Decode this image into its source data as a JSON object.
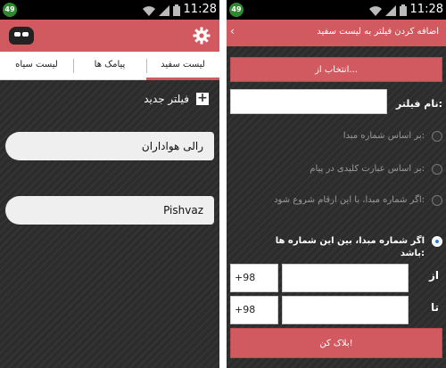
{
  "status_bar": {
    "badge": "49",
    "time": "11:28"
  },
  "left_screen": {
    "tabs": [
      {
        "label": "لیست سفید",
        "active": true
      },
      {
        "label": "پیامک ها",
        "active": false
      },
      {
        "label": "لیست سیاه",
        "active": false
      }
    ],
    "new_filter_label": "فیلتر جدید",
    "filters": [
      "رالی هواداران",
      "Pishvaz"
    ]
  },
  "right_screen": {
    "title": "اضافه کردن فیلتر به لیست سفید",
    "select_button": "انتخاب از...",
    "name_label": "نام فیلتر:",
    "name_value": "",
    "options": [
      {
        "text": "بر اساس شماره مبدا:",
        "selected": false
      },
      {
        "text": "بر اساس عبارت کلیدی در پیام:",
        "selected": false
      },
      {
        "text": "اگر شماره مبدا، با این ارقام شروع شود:",
        "selected": false
      },
      {
        "text": "اگر شماره مبدا، بین این شماره ها باشد:",
        "selected": true
      }
    ],
    "from_label": "از",
    "to_label": "تا",
    "from_prefix": "+98",
    "to_prefix": "+98",
    "block_button": "بلاک کن!"
  },
  "colors": {
    "accent": "#d05a5f",
    "background": "#2c2c2c",
    "radio_selected": "#2b7fe0"
  }
}
